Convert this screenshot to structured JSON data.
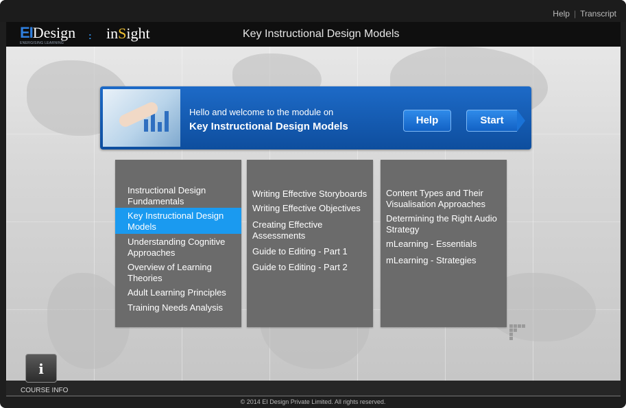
{
  "top_links": {
    "help": "Help",
    "separator": "|",
    "transcript": "Transcript"
  },
  "header": {
    "logo_ei": "EI",
    "logo_design": "Design",
    "logo_tagline": "ENERGISING LEARNING",
    "logo_separator": ":",
    "product_in": "in",
    "product_s": "S",
    "product_ight": "ight",
    "title": "Key Instructional Design Models"
  },
  "welcome": {
    "line1": "Hello and welcome to the module on",
    "line2": "Key Instructional Design Models",
    "help_button": "Help",
    "start_button": "Start"
  },
  "menu": {
    "column1": [
      {
        "label": "Instructional Design Fundamentals",
        "active": false
      },
      {
        "label": "Key Instructional Design Models",
        "active": true
      },
      {
        "label": "Understanding Cognitive Approaches",
        "active": false
      },
      {
        "label": "Overview of Learning Theories",
        "active": false
      },
      {
        "label": "Adult Learning Principles",
        "active": false
      },
      {
        "label": "Training Needs Analysis",
        "active": false
      }
    ],
    "column2": [
      {
        "label": "Writing Effective Storyboards"
      },
      {
        "label": "Writing Effective Objectives"
      },
      {
        "label": "Creating Effective Assessments"
      },
      {
        "label": "Guide to Editing - Part 1"
      },
      {
        "label": "Guide to Editing - Part 2"
      }
    ],
    "column3": [
      {
        "label": "Content Types and Their Visualisation Approaches"
      },
      {
        "label": "Determining the Right Audio Strategy"
      },
      {
        "label": "mLearning - Essentials"
      },
      {
        "label": "mLearning - Strategies"
      }
    ]
  },
  "course_info": {
    "icon": "info-icon",
    "glyph": "i",
    "label": "COURSE INFO"
  },
  "footer": {
    "copyright": "© 2014 EI Design Private Limited. All rights reserved."
  },
  "colors": {
    "accent_blue": "#1a9af0",
    "banner_blue": "#1d6ac7",
    "menu_gray": "#6b6b6b"
  }
}
